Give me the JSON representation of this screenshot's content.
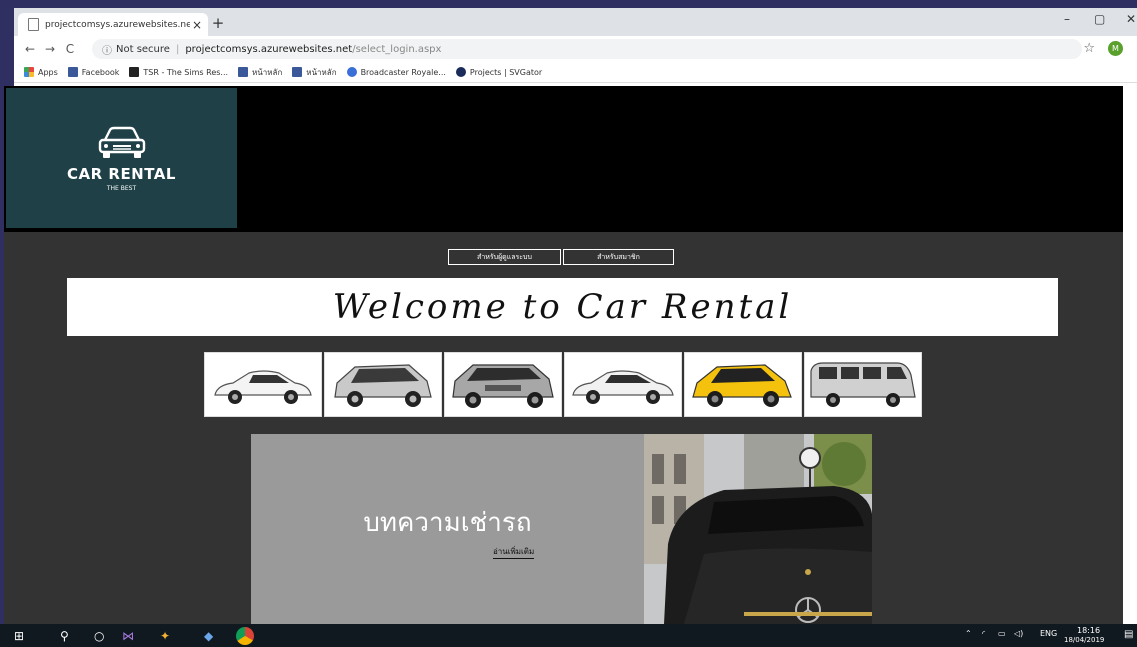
{
  "browser": {
    "tab_title": "projectcomsys.azurewebsites.ne",
    "close_glyph": "×",
    "new_tab_glyph": "+",
    "window_min": "–",
    "window_max": "▢",
    "window_close": "✕",
    "back_glyph": "←",
    "forward_glyph": "→",
    "reload_glyph": "C",
    "security_label": "Not secure",
    "url_host": "projectcomsys.azurewebsites.net",
    "url_path": "/select_login.aspx",
    "profile_initial": "M",
    "bookmarks": [
      {
        "label": "Apps",
        "color": "#e8453c"
      },
      {
        "label": "Facebook",
        "color": "#3b5998"
      },
      {
        "label": "TSR - The Sims Res...",
        "color": "#222222"
      },
      {
        "label": "หน้าหลัก",
        "color": "#3b5998"
      },
      {
        "label": "หน้าหลัก",
        "color": "#3b5998"
      },
      {
        "label": "Broadcaster Royale...",
        "color": "#3a6fd8"
      },
      {
        "label": "Projects | SVGator",
        "color": "#1a2a5a"
      }
    ]
  },
  "logo": {
    "title": "CAR RENTAL",
    "subtitle": "THE BEST",
    "background": "#1f4047"
  },
  "login_buttons": {
    "admin": "สำหรับผู้ดูแลระบบ",
    "member": "สำหรับสมาชิก"
  },
  "welcome_text": "Welcome to Car Rental",
  "car_thumbnails": [
    {
      "icon": "white-sedan",
      "color": "#f4f4f4"
    },
    {
      "icon": "silver-suv",
      "color": "#c9c9c9"
    },
    {
      "icon": "grey-pickup-suv",
      "color": "#a7a7a7"
    },
    {
      "icon": "white-compact-sedan",
      "color": "#f1f1f1"
    },
    {
      "icon": "yellow-hatchback",
      "color": "#f4c20d"
    },
    {
      "icon": "silver-van",
      "color": "#d0d0d0"
    }
  ],
  "article": {
    "title": "บทความเช่ารถ",
    "link": "อ่านเพิ่มเติม"
  },
  "taskbar": {
    "lang": "ENG",
    "time": "18:16",
    "date": "18/04/2019"
  }
}
